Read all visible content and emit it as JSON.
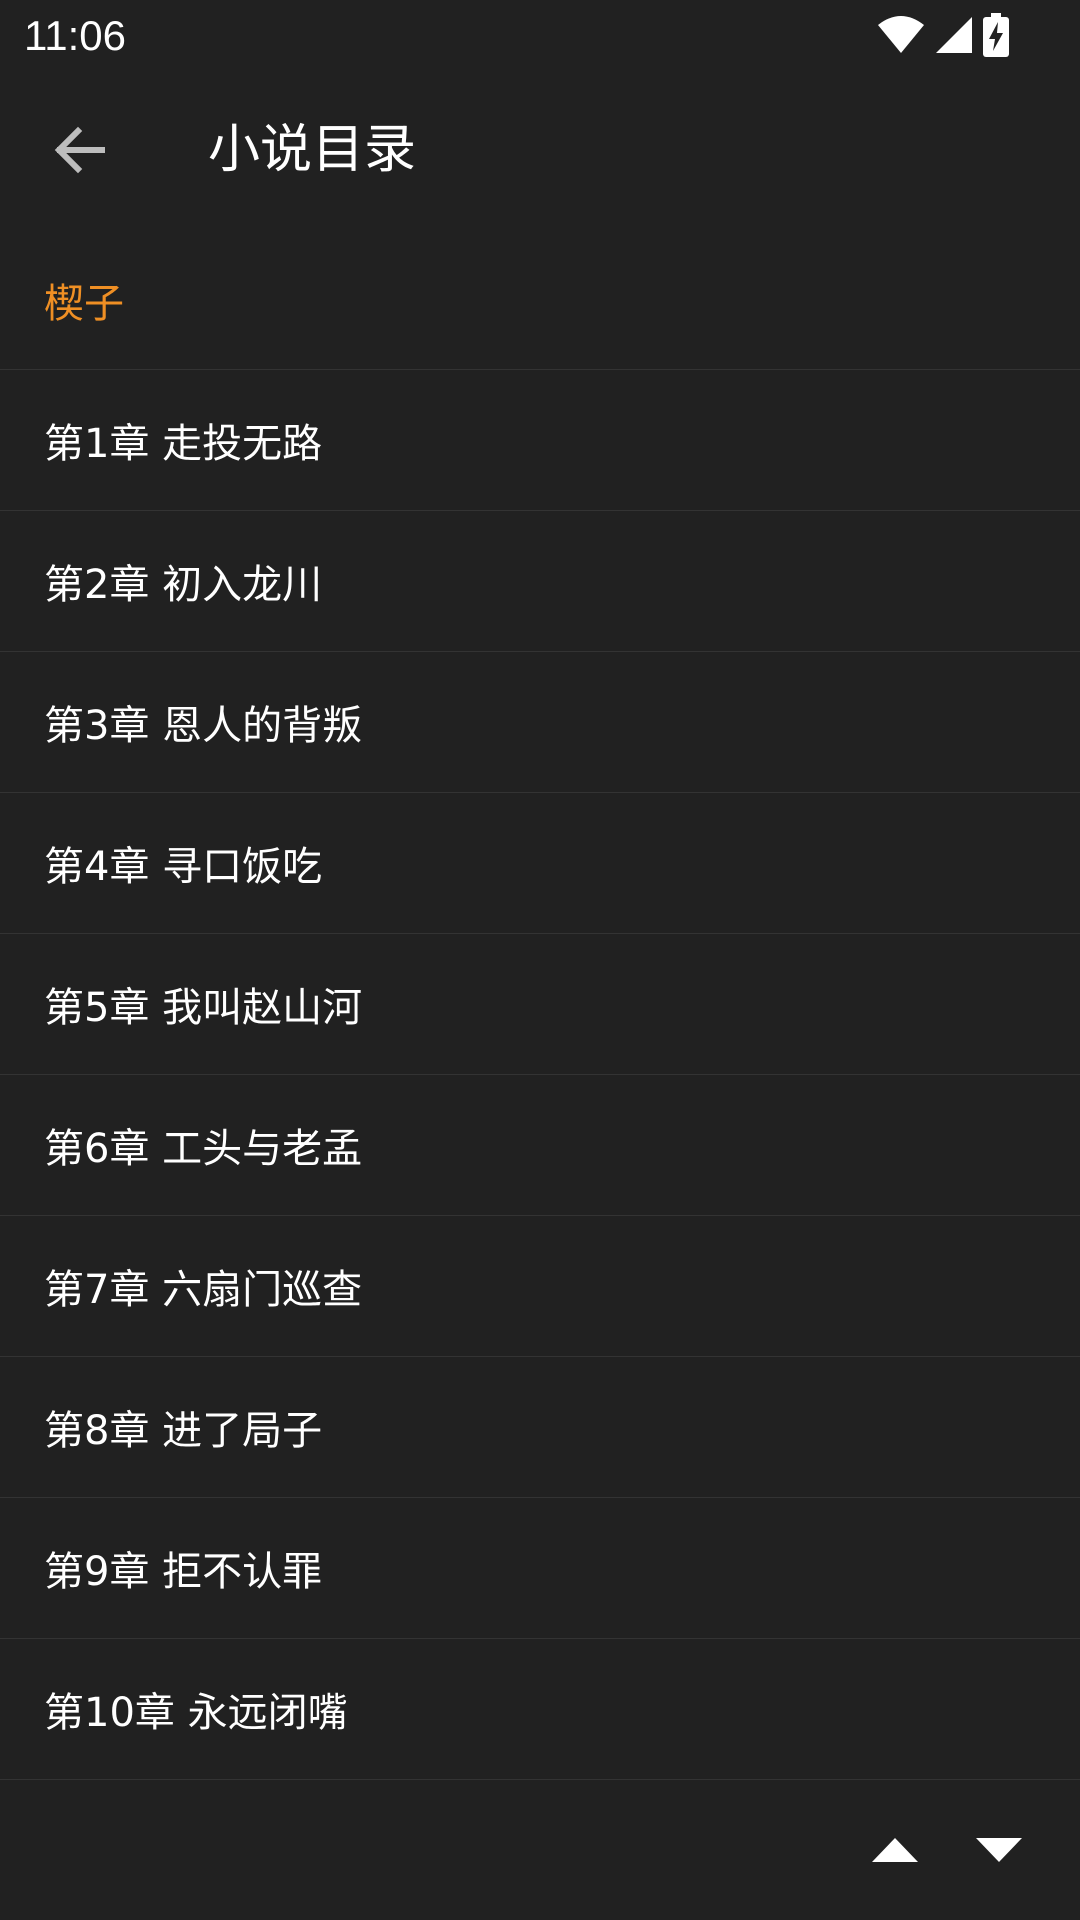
{
  "status_bar": {
    "time": "11:06",
    "icons": [
      "wifi-icon",
      "cell-signal-icon",
      "battery-charging-icon"
    ]
  },
  "app_bar": {
    "back_icon": "arrow-back-icon",
    "title": "小说目录"
  },
  "colors": {
    "background": "#212121",
    "accent": "#ef8f24",
    "divider": "#333333",
    "text": "#ffffff"
  },
  "chapters": [
    {
      "label": "楔子",
      "current": true
    },
    {
      "label": "第1章 走投无路",
      "current": false
    },
    {
      "label": "第2章 初入龙川",
      "current": false
    },
    {
      "label": "第3章 恩人的背叛",
      "current": false
    },
    {
      "label": "第4章 寻口饭吃",
      "current": false
    },
    {
      "label": "第5章 我叫赵山河",
      "current": false
    },
    {
      "label": "第6章 工头与老孟",
      "current": false
    },
    {
      "label": "第7章 六扇门巡查",
      "current": false
    },
    {
      "label": "第8章 进了局子",
      "current": false
    },
    {
      "label": "第9章 拒不认罪",
      "current": false
    },
    {
      "label": "第10章 永远闭嘴",
      "current": false
    }
  ],
  "scroll_controls": {
    "up_icon": "triangle-up-icon",
    "down_icon": "triangle-down-icon"
  }
}
